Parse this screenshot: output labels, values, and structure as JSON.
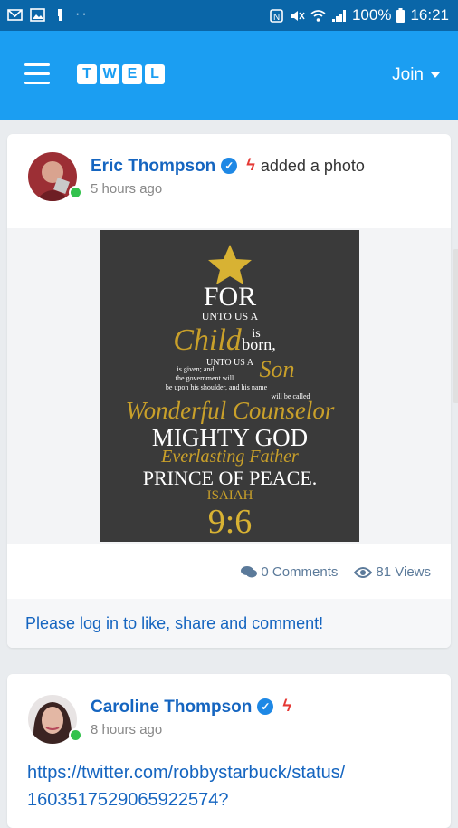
{
  "status_bar": {
    "battery": "100%",
    "time": "16:21"
  },
  "app": {
    "logo_letters": [
      "T",
      "W",
      "E",
      "L"
    ],
    "join_label": "Join",
    "accent": "#1b9ef2"
  },
  "posts": [
    {
      "author": "Eric Thompson",
      "action": "added a photo",
      "time": "5 hours ago",
      "poster_lines": [
        "FOR",
        "UNTO US A",
        "is",
        "Child",
        "born,",
        "UNTO US A",
        "Son",
        "is given; and",
        "the government will",
        "be upon his shoulder, and his name",
        "will be called",
        "Wonderful Counselor",
        "MIGHTY GOD",
        "Everlasting Father",
        "PRINCE OF PEACE.",
        "ISAIAH",
        "9:6"
      ],
      "comments": "0 Comments",
      "views": "81 Views",
      "login_prompt": "Please log in to like, share and comment!"
    },
    {
      "author": "Caroline Thompson",
      "time": "8 hours ago",
      "link_line1": "https://twitter.com/robbystarbuck/status/",
      "link_line2": "1603517529065922574?"
    }
  ]
}
